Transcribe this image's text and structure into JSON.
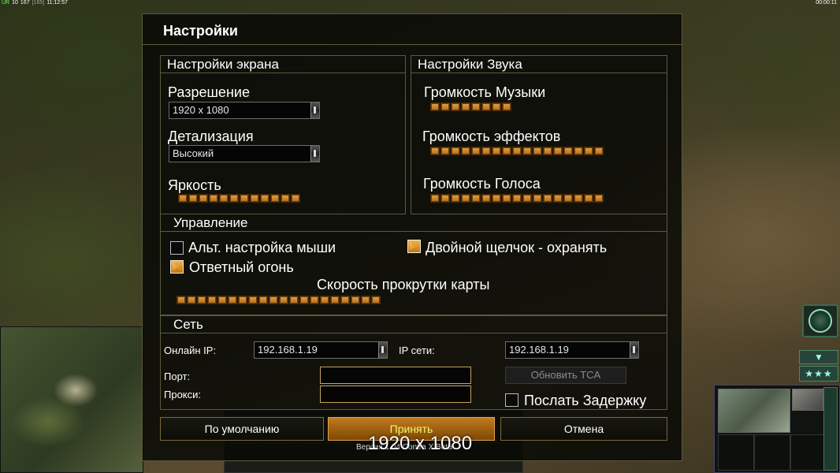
{
  "hud": {
    "left": {
      "a": "UR",
      "b": "10",
      "c": "167",
      "d": "[165]",
      "clock": "11:12:57"
    },
    "right_timer": "00:00:11"
  },
  "dialog": {
    "title": "Настройки",
    "screen": {
      "heading": "Настройки экрана",
      "resolution_label": "Разрешение",
      "resolution_value": "1920 x 1080",
      "detail_label": "Детализация",
      "detail_value": "Высокий",
      "brightness_label": "Яркость",
      "brightness_level": 12
    },
    "sound": {
      "heading": "Настройки Звука",
      "music_label": "Громкость Музыки",
      "music_level": 8,
      "effects_label": "Громкость эффектов",
      "effects_level": 17,
      "voice_label": "Громкость Голоса",
      "voice_level": 17
    },
    "controls": {
      "heading": "Управление",
      "alt_mouse_label": "Альт. настройка мыши",
      "alt_mouse_checked": false,
      "double_click_label": "Двойной щелчок - охранять",
      "double_click_checked": true,
      "retaliation_label": "Ответный огонь",
      "retaliation_checked": true,
      "scroll_speed_label": "Скорость прокрутки карты",
      "scroll_speed_level": 20
    },
    "network": {
      "heading": "Сеть",
      "online_ip_label": "Онлайн IP:",
      "online_ip_value": "192.168.1.19",
      "lan_ip_label": "IP сети:",
      "lan_ip_value": "192.168.1.19",
      "port_label": "Порт:",
      "port_value": "",
      "proxy_label": "Прокси:",
      "proxy_value": "",
      "update_tca_label": "Обновить TCA",
      "send_delay_label": "Послать Задержку",
      "send_delay_checked": false
    },
    "buttons": {
      "defaults": "По умолчанию",
      "accept": "Принять",
      "cancel": "Отмена"
    }
  },
  "overlay": {
    "resolution_text": "1920 x 1080",
    "version_text": "Версия 1.04 Contra X Beta"
  },
  "sidebar": {
    "down_arrow": "▼",
    "stars": "★★★"
  }
}
